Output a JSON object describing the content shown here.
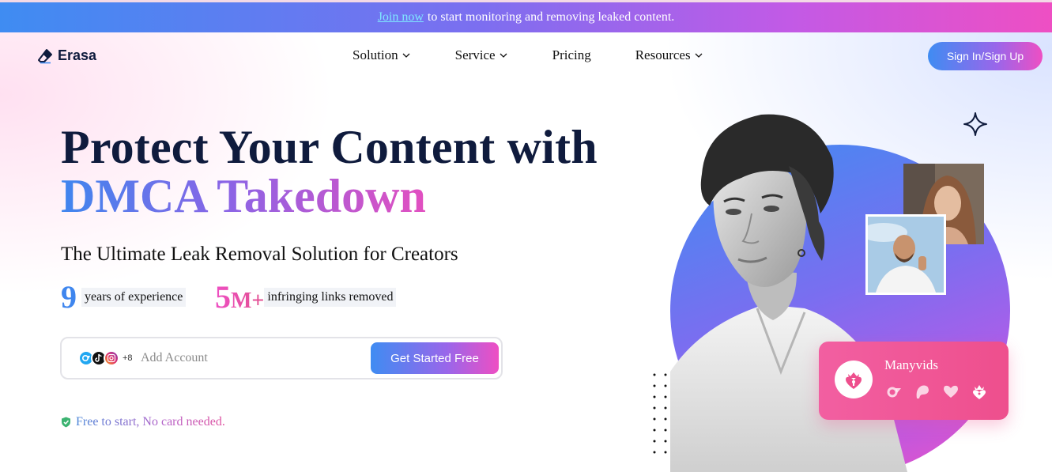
{
  "announcement": {
    "link_text": "Join now",
    "text": "to start monitoring and removing leaked content."
  },
  "logo": {
    "name": "Erasa",
    "icon": "eraser-icon"
  },
  "nav": {
    "items": [
      {
        "label": "Solution",
        "has_dropdown": true
      },
      {
        "label": "Service",
        "has_dropdown": true
      },
      {
        "label": "Pricing",
        "has_dropdown": false
      },
      {
        "label": "Resources",
        "has_dropdown": true
      }
    ],
    "signin_label": "Sign In/Sign Up"
  },
  "hero": {
    "title_line1": "Protect Your Content with",
    "title_line2": "DMCA Takedown",
    "subtitle": "The Ultimate Leak Removal Solution for Creators",
    "stats": [
      {
        "number": "9",
        "suffix": "",
        "label": "years of experience"
      },
      {
        "number": "5",
        "suffix": "M+",
        "label": "infringing links removed"
      }
    ]
  },
  "account_bar": {
    "platform_icons": [
      "onlyfans-icon",
      "tiktok-icon",
      "instagram-icon"
    ],
    "more_count": "+8",
    "placeholder": "Add Account",
    "button_label": "Get Started Free"
  },
  "free_note": {
    "text": "Free to start, No card needed.",
    "icon": "shield-check-icon"
  },
  "platform_card": {
    "name": "Manyvids",
    "icons": [
      "onlyfans-icon",
      "patreon-icon",
      "heart-icon",
      "manyvids-icon"
    ]
  },
  "colors": {
    "brand_blue": "#3f8cf2",
    "brand_purple": "#9a66ea",
    "brand_pink": "#ee4fc3",
    "navy": "#0f1b3d",
    "card_pink": "#f25fa1"
  }
}
